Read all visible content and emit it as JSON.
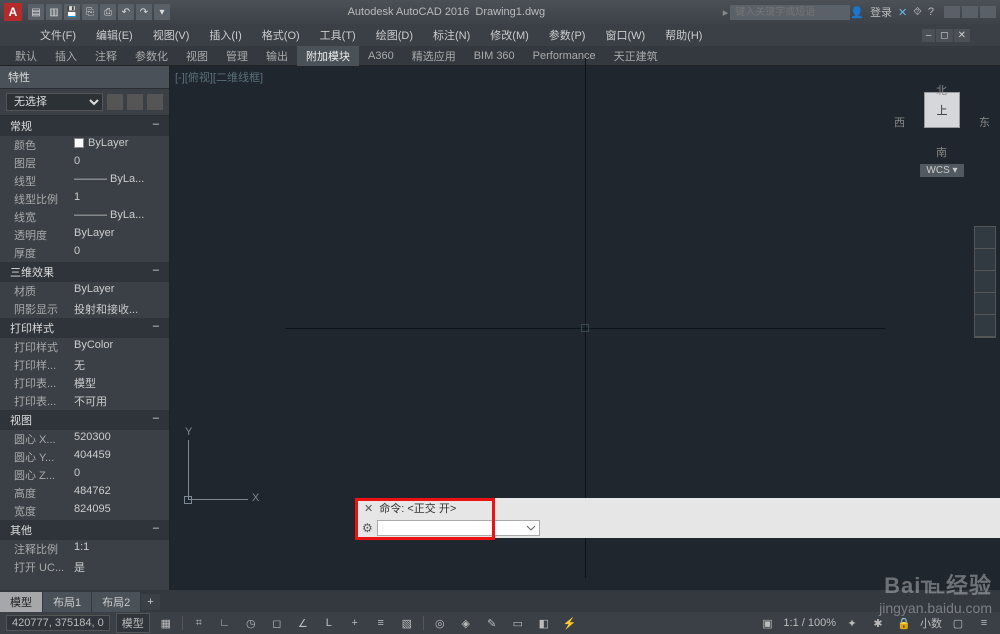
{
  "titlebar": {
    "app": "Autodesk AutoCAD 2016",
    "doc": "Drawing1.dwg",
    "search_placeholder": "键入关键字或短语",
    "login": "登录"
  },
  "menubar": [
    "文件(F)",
    "编辑(E)",
    "视图(V)",
    "插入(I)",
    "格式(O)",
    "工具(T)",
    "绘图(D)",
    "标注(N)",
    "修改(M)",
    "参数(P)",
    "窗口(W)",
    "帮助(H)"
  ],
  "ribbontabs": [
    "默认",
    "插入",
    "注释",
    "参数化",
    "视图",
    "管理",
    "输出",
    "附加模块",
    "A360",
    "精选应用",
    "BIM 360",
    "Performance",
    "天正建筑"
  ],
  "ribbon_active_index": 7,
  "palette": {
    "title": "特性",
    "selection": "无选择",
    "sections": [
      {
        "name": "常规",
        "rows": [
          {
            "k": "颜色",
            "v": "ByLayer",
            "swatch": true
          },
          {
            "k": "图层",
            "v": "0"
          },
          {
            "k": "线型",
            "v": "——— ByLa..."
          },
          {
            "k": "线型比例",
            "v": "1"
          },
          {
            "k": "线宽",
            "v": "——— ByLa..."
          },
          {
            "k": "透明度",
            "v": "ByLayer"
          },
          {
            "k": "厚度",
            "v": "0"
          }
        ]
      },
      {
        "name": "三维效果",
        "rows": [
          {
            "k": "材质",
            "v": "ByLayer"
          },
          {
            "k": "阴影显示",
            "v": "投射和接收..."
          }
        ]
      },
      {
        "name": "打印样式",
        "rows": [
          {
            "k": "打印样式",
            "v": "ByColor"
          },
          {
            "k": "打印样...",
            "v": "无"
          },
          {
            "k": "打印表...",
            "v": "模型"
          },
          {
            "k": "打印表...",
            "v": "不可用"
          }
        ]
      },
      {
        "name": "视图",
        "rows": [
          {
            "k": "圆心 X...",
            "v": "520300"
          },
          {
            "k": "圆心 Y...",
            "v": "404459"
          },
          {
            "k": "圆心 Z...",
            "v": "0"
          },
          {
            "k": "高度",
            "v": "484762"
          },
          {
            "k": "宽度",
            "v": "824095"
          }
        ]
      },
      {
        "name": "其他",
        "rows": [
          {
            "k": "注释比例",
            "v": "1:1"
          },
          {
            "k": "打开 UC...",
            "v": "是"
          }
        ]
      }
    ]
  },
  "viewport": {
    "tag": "[-][俯视][二维线框]",
    "ucs_x": "X",
    "ucs_y": "Y"
  },
  "viewcube": {
    "n": "北",
    "s": "南",
    "e": "东",
    "w": "西",
    "top": "上",
    "wcs": "WCS"
  },
  "cmd": {
    "hist_label": "命令:",
    "hist_value": "<正交 开>",
    "input": ""
  },
  "layouts": [
    "模型",
    "布局1",
    "布局2"
  ],
  "statusbar": {
    "coord": "420777, 375184, 0",
    "space": "模型",
    "scale": "1:1 / 100%",
    "right_text": "小数"
  },
  "watermark": {
    "brand": "Bai℡经验",
    "url": "jingyan.baidu.com"
  }
}
